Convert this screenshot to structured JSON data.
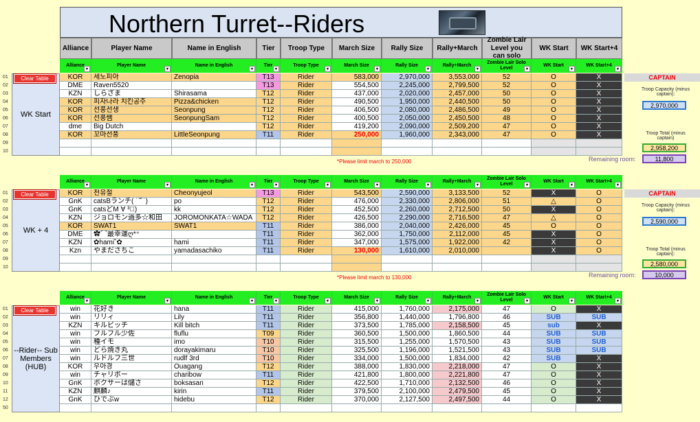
{
  "title": "Northern Turret--Riders",
  "columns": [
    "Alliance",
    "Player Name",
    "Name in English",
    "Tier",
    "Troop Type",
    "March Size",
    "Rally Size",
    "Rally+March",
    "Zombie Lair Level you can solo",
    "WK Start",
    "WK Start+4"
  ],
  "grid_columns": [
    "Alliance",
    "Player Name",
    "Name in English",
    "Tier",
    "Troop Type",
    "March Size",
    "Rally Size",
    "Rally+March",
    "Zombie Lair Solo Level",
    "WK Start",
    "WK Start+4"
  ],
  "clear_label": "Clear Table",
  "section1": {
    "label": "WK Start",
    "row_numbers": [
      "01",
      "02",
      "03",
      "04",
      "05",
      "06",
      "07",
      "08",
      "09",
      "10"
    ],
    "rows": [
      [
        "KOR",
        "세노피아",
        "Zenopia",
        "T13",
        "Rider",
        "583,000",
        "2,970,000",
        "3,553,000",
        "52",
        "O",
        "X"
      ],
      [
        "DME",
        "Raven5520",
        "",
        "T13",
        "Rider",
        "554,500",
        "2,245,000",
        "2,799,500",
        "52",
        "O",
        "X"
      ],
      [
        "KZN",
        "しらざま",
        "Shirasama",
        "T12",
        "Rider",
        "437,000",
        "2,020,000",
        "2,457,000",
        "50",
        "O",
        "X"
      ],
      [
        "KOR",
        "피자나라 치킨공주",
        "Pizza&chicken",
        "T12",
        "Rider",
        "490,500",
        "1,950,000",
        "2,440,500",
        "50",
        "O",
        "X"
      ],
      [
        "KOR",
        "선풍선생",
        "Seonpung",
        "T12",
        "Rider",
        "406,500",
        "2,080,000",
        "2,486,500",
        "49",
        "O",
        "X"
      ],
      [
        "KOR",
        "선풍쌤",
        "SeonpungSam",
        "T12",
        "Rider",
        "400,500",
        "2,050,000",
        "2,450,500",
        "48",
        "O",
        "X"
      ],
      [
        "dme",
        "Big Dutch",
        "",
        "T12",
        "Rider",
        "419,200",
        "2,090,000",
        "2,509,200",
        "47",
        "O",
        "X"
      ],
      [
        "KOR",
        "꼬마선풍",
        "LittleSeonpung",
        "T11",
        "Rider",
        "250,000",
        "1,960,000",
        "2,343,000",
        "47",
        "O",
        "X"
      ]
    ],
    "note": "*Please limit march to 250,000",
    "captain": "CAPTAIN",
    "capacity_label": "Troop Capacity (minus captain):",
    "capacity_value": "2,970,000",
    "total_label": "Troop Total (minus captain)",
    "total_value": "2,958,200",
    "remaining_label": "Remaining room:",
    "remaining_value": "11,800"
  },
  "section2": {
    "label": "WK + 4",
    "row_numbers": [
      "01",
      "02",
      "03",
      "04",
      "05",
      "06",
      "07",
      "08",
      "09",
      "10"
    ],
    "rows": [
      [
        "KOR",
        "천유절",
        "Cheonyujeol",
        "T13",
        "Rider",
        "543,500",
        "2,590,000",
        "3,133,500",
        "52",
        "X",
        "O"
      ],
      [
        "GnK",
        "catsBランチ( ˙꒳˙)",
        "po",
        "T12",
        "Rider",
        "476,000",
        "2,330,000",
        "2,806,000",
        "51",
        "△",
        "O"
      ],
      [
        "GnK",
        "catsどM ∀ ³゚)",
        "kk",
        "T12",
        "Rider",
        "452,500",
        "2,260,000",
        "2,712,500",
        "50",
        "X",
        "O"
      ],
      [
        "KZN",
        "ジョロモン過多☆和田",
        "JOROMONKATA☆WADA",
        "T12",
        "Rider",
        "426,500",
        "2,290,000",
        "2,716,500",
        "47",
        "△",
        "O"
      ],
      [
        "KOR",
        "SWAT1",
        "SWAT1",
        "T11",
        "Rider",
        "386,000",
        "2,040,000",
        "2,426,000",
        "45",
        "O",
        "O"
      ],
      [
        "DME",
        "✿⌒最幸運ღ*⁺",
        "",
        "T11",
        "Rider",
        "362,000",
        "1,750,000",
        "2,112,000",
        "45",
        "X",
        "O"
      ],
      [
        "KZN",
        "✿hami˘✿",
        "hami",
        "T11",
        "Rider",
        "347,000",
        "1,575,000",
        "1,922,000",
        "42",
        "X",
        "O"
      ],
      [
        "Kzn",
        "やまださちこ",
        "yamadasachiko",
        "T11",
        "Rider",
        "130,000",
        "1,610,000",
        "2,010,000",
        "",
        "X",
        "O"
      ]
    ],
    "note": "*Please limit march to 130,000",
    "captain": "CAPTAIN",
    "capacity_label": "Troop Capacity (minus captain):",
    "capacity_value": "2,590,000",
    "total_label": "Troop Total (minus captain):",
    "total_value": "2,580,000",
    "remaining_label": "Remaining room:",
    "remaining_value": "10,000"
  },
  "section3": {
    "label": "--Rider-- Sub Members (HUB)",
    "row_numbers": [
      "01",
      "02",
      "03",
      "04",
      "05",
      "06",
      "07",
      "08",
      "09",
      "10",
      "11",
      "12",
      "50"
    ],
    "rows": [
      [
        "win",
        "花好き",
        "hana",
        "T11",
        "Rider",
        "415,000",
        "1,760,000",
        "2,175,000",
        "47",
        "O",
        "X"
      ],
      [
        "win",
        "リリィ",
        "Lily",
        "T11",
        "Rider",
        "356,800",
        "1,440,000",
        "1,796,800",
        "46",
        "SUB",
        "SUB"
      ],
      [
        "KZN",
        "キルビッチ",
        "Kill bitch",
        "T11",
        "Rider",
        "373,500",
        "1,785,000",
        "2,158,500",
        "45",
        "sub",
        "X"
      ],
      [
        "win",
        "フルフル少佐",
        "fluflu",
        "T09",
        "Rider",
        "360,500",
        "1,500,000",
        "1,860,500",
        "44",
        "SUB",
        "SUB"
      ],
      [
        "win",
        "種イモ",
        "imo",
        "T10",
        "Rider",
        "315,500",
        "1,255,000",
        "1,570,500",
        "43",
        "SUB",
        "SUB"
      ],
      [
        "win",
        "どら焼き丸",
        "dorayakimaru",
        "T10",
        "Rider",
        "325,500",
        "1,196,000",
        "1,521,500",
        "43",
        "SUB",
        "SUB"
      ],
      [
        "win",
        "ルドルフ三世",
        "rudlf 3rd",
        "T10",
        "Rider",
        "334,000",
        "1,500,000",
        "1,834,000",
        "42",
        "SUB",
        "X"
      ],
      [
        "KOR",
        "우아경",
        "Ouagang",
        "T12",
        "Rider",
        "388,000",
        "1,830,000",
        "2,218,000",
        "47",
        "O",
        "X"
      ],
      [
        "win",
        "チャリボー",
        "charibow",
        "T11",
        "Rider",
        "421,800",
        "1,800,000",
        "2,221,800",
        "47",
        "O",
        "X"
      ],
      [
        "GnK",
        "ボクサーは儲さ",
        "boksasan",
        "T12",
        "Rider",
        "422,500",
        "1,710,000",
        "2,132,500",
        "46",
        "O",
        "X"
      ],
      [
        "KZN",
        "麒麟♪",
        "kirin",
        "T11",
        "Rider",
        "379,500",
        "2,100,000",
        "2,479,500",
        "45",
        "O",
        "X"
      ],
      [
        "GnK",
        "ひでぶw",
        "hidebu",
        "T12",
        "Rider",
        "370,000",
        "2,127,500",
        "2,497,500",
        "44",
        "O",
        "X"
      ]
    ]
  }
}
